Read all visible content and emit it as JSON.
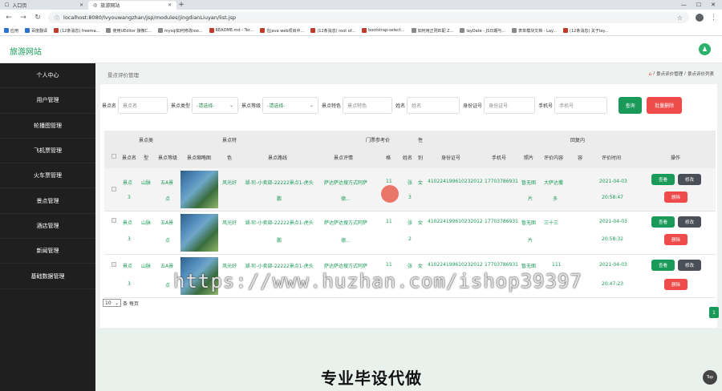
{
  "browser": {
    "tabs": [
      {
        "title": "入口页"
      },
      {
        "title": "旅游网站"
      }
    ],
    "url": "localhost:8080/lvyouwangzhan/jsp/modules/jingdianLiuyan/list.jsp",
    "bookmarks": [
      "应用",
      "百度翻译",
      "(12条消息) freema...",
      "使用UEditor 接微C...",
      "mysql如何修改roo...",
      "README.md - Ter...",
      "在java web项目中...",
      "(12条消息) root of...",
      "bootstrap-select...",
      "如何用正则匹配 Z...",
      "layDate - JS日期与...",
      "表单模块文档 - Lay...",
      "(12条消息) 关于lay..."
    ]
  },
  "header": {
    "brand": "旅游网站",
    "avatar_glyph": "♟"
  },
  "sidebar": {
    "items": [
      "个人中心",
      "用户管理",
      "轮播图管理",
      "飞机票管理",
      "火车票管理",
      "景点管理",
      "酒店管理",
      "新闻管理",
      "基础数据管理"
    ]
  },
  "page": {
    "title": "景点评价管理",
    "breadcrumb": [
      "/",
      "景点评价管理",
      "/",
      "景点评价列表"
    ]
  },
  "filters": {
    "name_label": "景点名",
    "name_placeholder": "景点名",
    "type_label": "景点类型",
    "type_value": "-请选择-",
    "level_label": "景点等级",
    "level_value": "-请选择-",
    "feature_label": "景点特色",
    "feature_placeholder": "景点特色",
    "person_label": "姓名",
    "person_placeholder": "姓名",
    "id_label": "身份证号",
    "id_placeholder": "身份证号",
    "phone_label": "手机号",
    "phone_placeholder": "手机号",
    "search_button": "查询",
    "batch_delete_button": "批量删除"
  },
  "table": {
    "headers_top": {
      "type": "景点类",
      "feature": "景点特",
      "price": "门票参考价",
      "gender": "性",
      "reply": "回复内"
    },
    "headers": {
      "name": "景点名",
      "type": "型",
      "level": "景点等级",
      "thumb": "景点缩略图",
      "feature": "色",
      "route": "景点路线",
      "review": "景点评情",
      "price": "格",
      "person": "姓名",
      "gender": "别",
      "idcard": "身份证号",
      "phone": "手机号",
      "photo": "照片",
      "content": "评价内容",
      "reply": "容",
      "time": "评价时间",
      "ops": "操作"
    },
    "rows": [
      {
        "name": "景点",
        "name2": "3",
        "type": "山脉",
        "level": "五A景",
        "level2": "点",
        "feature": "风光好",
        "route": "湖-阶-小卖部-22222景点1-虎头",
        "route2": "鹏",
        "review": "萨达萨达搜方式阿萨",
        "review2": "德...",
        "price": "11",
        "person": "张",
        "person2": "3",
        "gender": "女",
        "idcard": "410224199610232012",
        "phone": "17703786931",
        "photo": "暂无图",
        "photo2": "片",
        "content": "大萨达撒",
        "content2": "多",
        "reply": "",
        "date": "2021-04-03",
        "time": "20:58:47"
      },
      {
        "name": "景点",
        "name2": "3",
        "type": "山脉",
        "level": "五A景",
        "level2": "点",
        "feature": "风光好",
        "route": "湖-阶-小卖部-22222景点1-虎头",
        "route2": "鹏",
        "review": "萨达萨达搜方式阿萨",
        "review2": "德...",
        "price": "11",
        "person": "张",
        "person2": "2",
        "gender": "女",
        "idcard": "410224199610232012",
        "phone": "17703786931",
        "photo": "暂无图",
        "photo2": "片",
        "content": "三十三",
        "content2": "",
        "reply": "",
        "date": "2021-04-03",
        "time": "20:58:32"
      },
      {
        "name": "景点",
        "name2": "3",
        "type": "山脉",
        "level": "五A景",
        "level2": "点",
        "feature": "风光好",
        "route": "湖-阶-小卖部-22222景点1-虎头",
        "route2": "鹏",
        "review": "萨达萨达搜方式阿萨",
        "review2": "德...",
        "price": "11",
        "person": "张",
        "person2": "1",
        "gender": "女",
        "idcard": "410224199610232012",
        "phone": "17703786931",
        "photo": "暂无图",
        "photo2": "片",
        "content": "111",
        "content2": "",
        "reply": "",
        "date": "2021-04-03",
        "time": "20:47:23"
      }
    ],
    "view_label": "查看",
    "edit_label": "修改",
    "delete_label": "删除"
  },
  "pager": {
    "page_size": "10",
    "suffix": "条 每页",
    "current_page": "1"
  },
  "promo": {
    "text": "专业毕设代做"
  },
  "top_button": "Top",
  "watermark": "https://www.huzhan.com/ishop39397"
}
